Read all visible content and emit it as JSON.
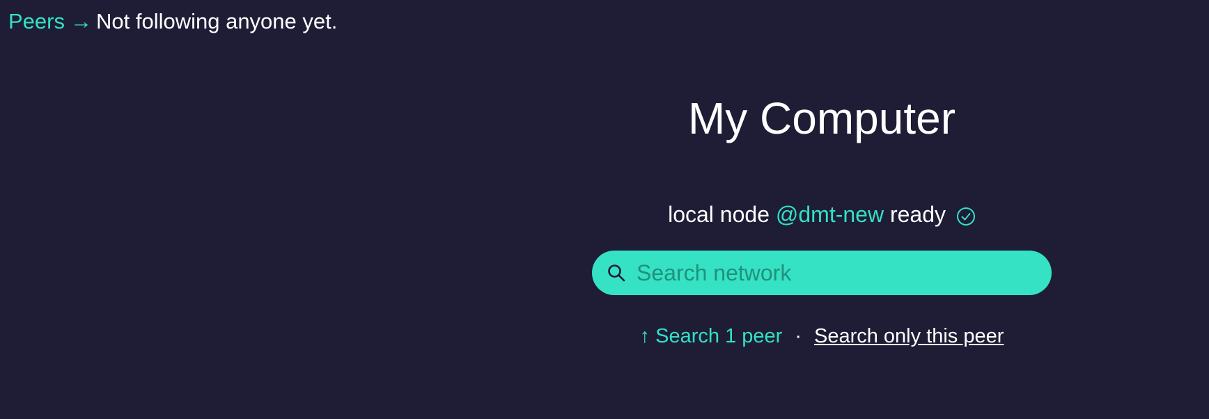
{
  "breadcrumb": {
    "link_label": "Peers",
    "arrow": "→",
    "status_text": "Not following anyone yet."
  },
  "main": {
    "title": "My Computer",
    "node_status": {
      "prefix": "local node",
      "handle": "@dmt-new",
      "suffix": "ready",
      "icon": "check-circle-icon"
    },
    "search": {
      "placeholder": "Search network",
      "value": "",
      "icon": "search-icon"
    },
    "options": {
      "search_peers_label": "↑ Search 1 peer",
      "separator": "·",
      "search_only_this_peer_label": "Search only this peer"
    }
  },
  "colors": {
    "background": "#1e1d35",
    "accent": "#33e0c6",
    "search_bar": "#35e3c4",
    "text": "#ffffff"
  }
}
